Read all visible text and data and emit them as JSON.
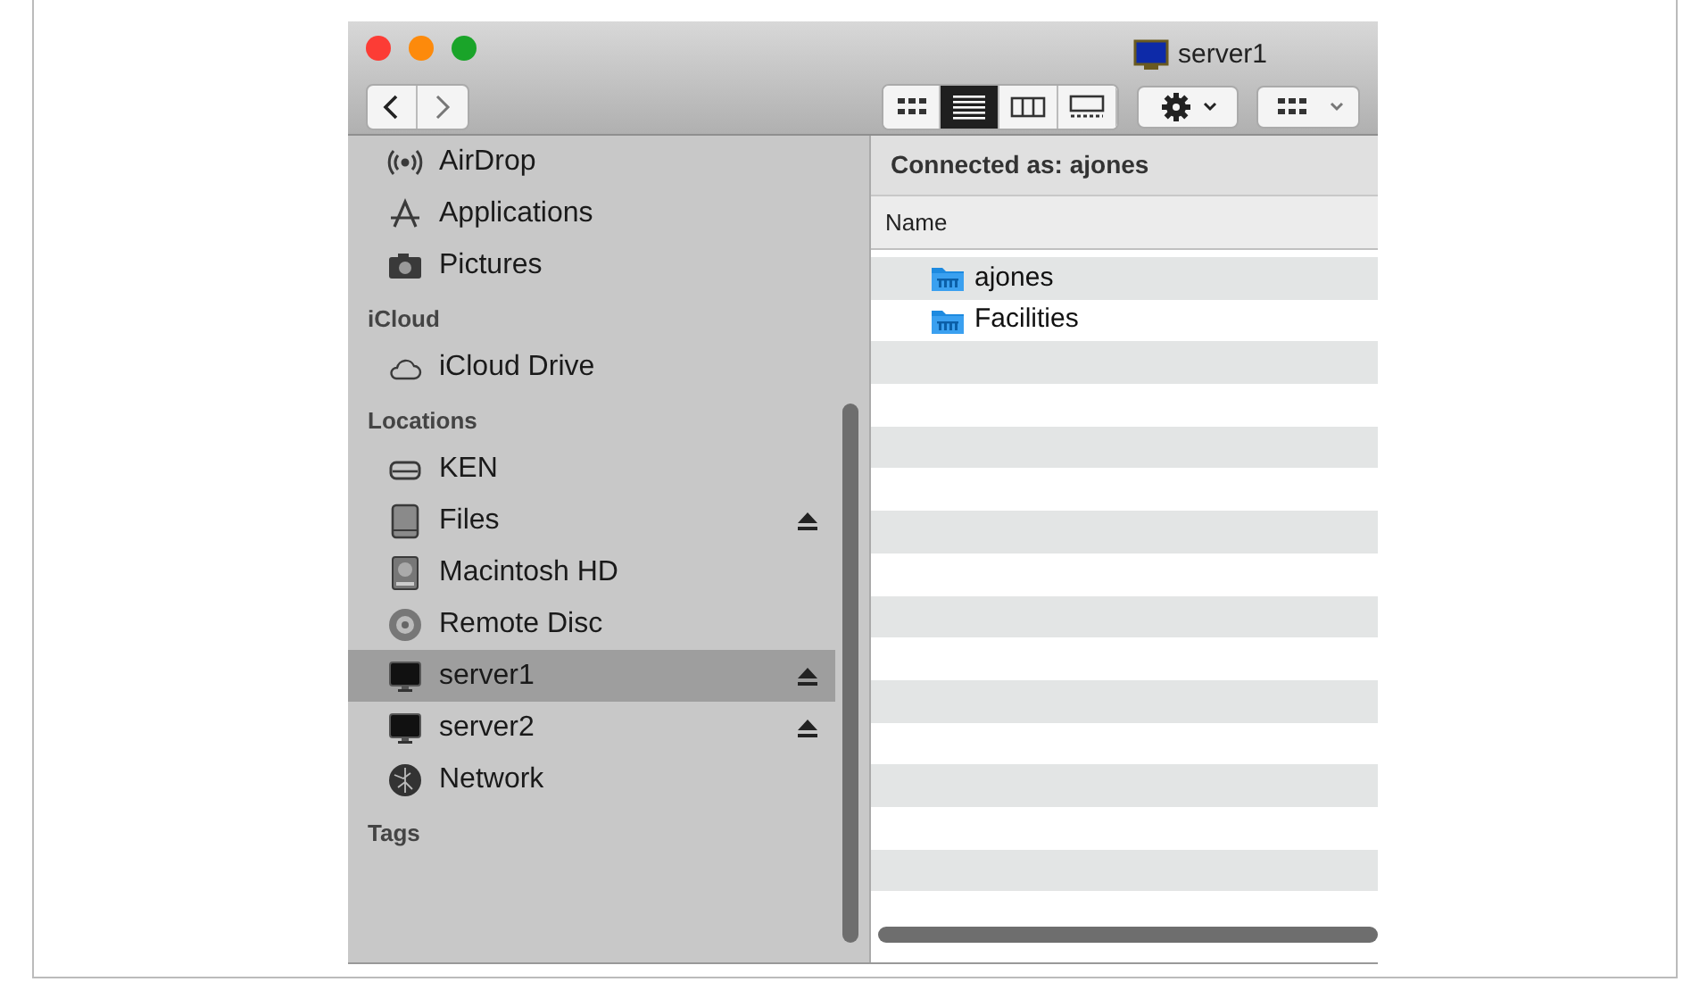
{
  "window": {
    "title": "server1"
  },
  "toolbar": {
    "view_modes": [
      {
        "kind": "icons",
        "selected": false
      },
      {
        "kind": "list",
        "selected": true
      },
      {
        "kind": "columns",
        "selected": false
      },
      {
        "kind": "gallery",
        "selected": false
      }
    ]
  },
  "sidebar": {
    "sections": [
      {
        "items": [
          {
            "label": "AirDrop",
            "kind": "airdrop",
            "eject": false,
            "selected": false
          },
          {
            "label": "Applications",
            "kind": "apps",
            "eject": false,
            "selected": false
          },
          {
            "label": "Pictures",
            "kind": "camera",
            "eject": false,
            "selected": false
          }
        ]
      },
      {
        "header": "iCloud",
        "items": [
          {
            "label": "iCloud Drive",
            "kind": "cloud",
            "eject": false,
            "selected": false
          }
        ]
      },
      {
        "header": "Locations",
        "items": [
          {
            "label": "KEN",
            "kind": "drive",
            "eject": false,
            "selected": false
          },
          {
            "label": "Files",
            "kind": "disk",
            "eject": true,
            "selected": false
          },
          {
            "label": "Macintosh HD",
            "kind": "hd",
            "eject": false,
            "selected": false
          },
          {
            "label": "Remote Disc",
            "kind": "disc",
            "eject": false,
            "selected": false
          },
          {
            "label": "server1",
            "kind": "monitor",
            "eject": true,
            "selected": true
          },
          {
            "label": "server2",
            "kind": "monitor",
            "eject": true,
            "selected": false
          },
          {
            "label": "Network",
            "kind": "globe",
            "eject": false,
            "selected": false
          }
        ]
      },
      {
        "header": "Tags"
      }
    ]
  },
  "content": {
    "status": "Connected as: ajones",
    "columns": [
      "Name"
    ],
    "rows": [
      {
        "name": "ajones"
      },
      {
        "name": "Facilities"
      }
    ]
  }
}
